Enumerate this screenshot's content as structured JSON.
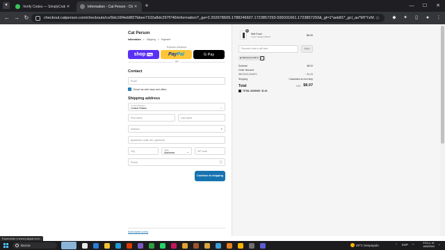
{
  "browser": {
    "tabs": [
      {
        "label": "Verify Codes — SimplyCodes",
        "active": false
      },
      {
        "label": "Information - Cat Person - Checkout",
        "active": true
      }
    ],
    "new_tab": "+",
    "url": "checkout.catperson.com/checkouts/co/9dc16f4eb8f27bbee7102a8dc297f746/information?_ga=2.202678609.1788246607.1723857293-595031661.1723857293&_gl=1*aeb81*_gcl_au*MTYzM...",
    "window_controls": {
      "minimize": "—",
      "maximize": "☐",
      "close": "✕"
    }
  },
  "checkout": {
    "store_name": "Cat Person",
    "breadcrumbs": [
      "Information",
      "Shipping",
      "Payment"
    ],
    "breadcrumb_sep": ">",
    "express_label": "Express checkout",
    "shoppay": {
      "label": "shop",
      "badge": "Pay"
    },
    "paypal": {
      "pay": "Pay",
      "pal": "Pal"
    },
    "gpay": "G Pay",
    "or_text": "OR",
    "contact_title": "Contact",
    "email_placeholder": "Email",
    "email_offers_label": "Email me with news and offers",
    "shipping_title": "Shipping address",
    "country": {
      "label": "Country/Region",
      "value": "United States"
    },
    "first_name_placeholder": "First name",
    "last_name_placeholder": "Last name",
    "address_placeholder": "Address",
    "apartment_placeholder": "Apartment, suite, etc. (optional)",
    "city_placeholder": "City",
    "state": {
      "label": "State",
      "value": "Alabama"
    },
    "zip_placeholder": "ZIP code",
    "phone_placeholder": "Phone",
    "continue_label": "Continue to shipping",
    "footer_link": "Subscription policy"
  },
  "order": {
    "quantity": "1",
    "item_name": "Wet Food",
    "item_variant": "Tuna / Steak & Broth",
    "item_price": "$8.00",
    "discount_placeholder": "Discount code or gift card",
    "apply_label": "Apply",
    "applied_code": "WECHOLOUM70",
    "remove_icon": "✕",
    "rows": {
      "subtotal": {
        "label": "Subtotal",
        "value": "$8.00"
      },
      "order_discount": {
        "label": "Order discount",
        "value": ""
      },
      "code": {
        "label": "WECHOLOUM70",
        "value": "− $1.43"
      },
      "shipping": {
        "label": "Shipping",
        "value": "Calculated at next step"
      }
    },
    "total_label": "Total",
    "total_currency": "USD",
    "total_value": "$8.07",
    "savings_label": "TOTAL SAVINGS",
    "savings_value": "$1.43"
  },
  "status_tooltip": "Esperando a www.paypal.com...",
  "taskbar": {
    "search_label": "Buscar",
    "weather": "29°C  Despejado",
    "language": "ESP",
    "time": "9:11 p. m.",
    "date": "16/8/2024"
  }
}
